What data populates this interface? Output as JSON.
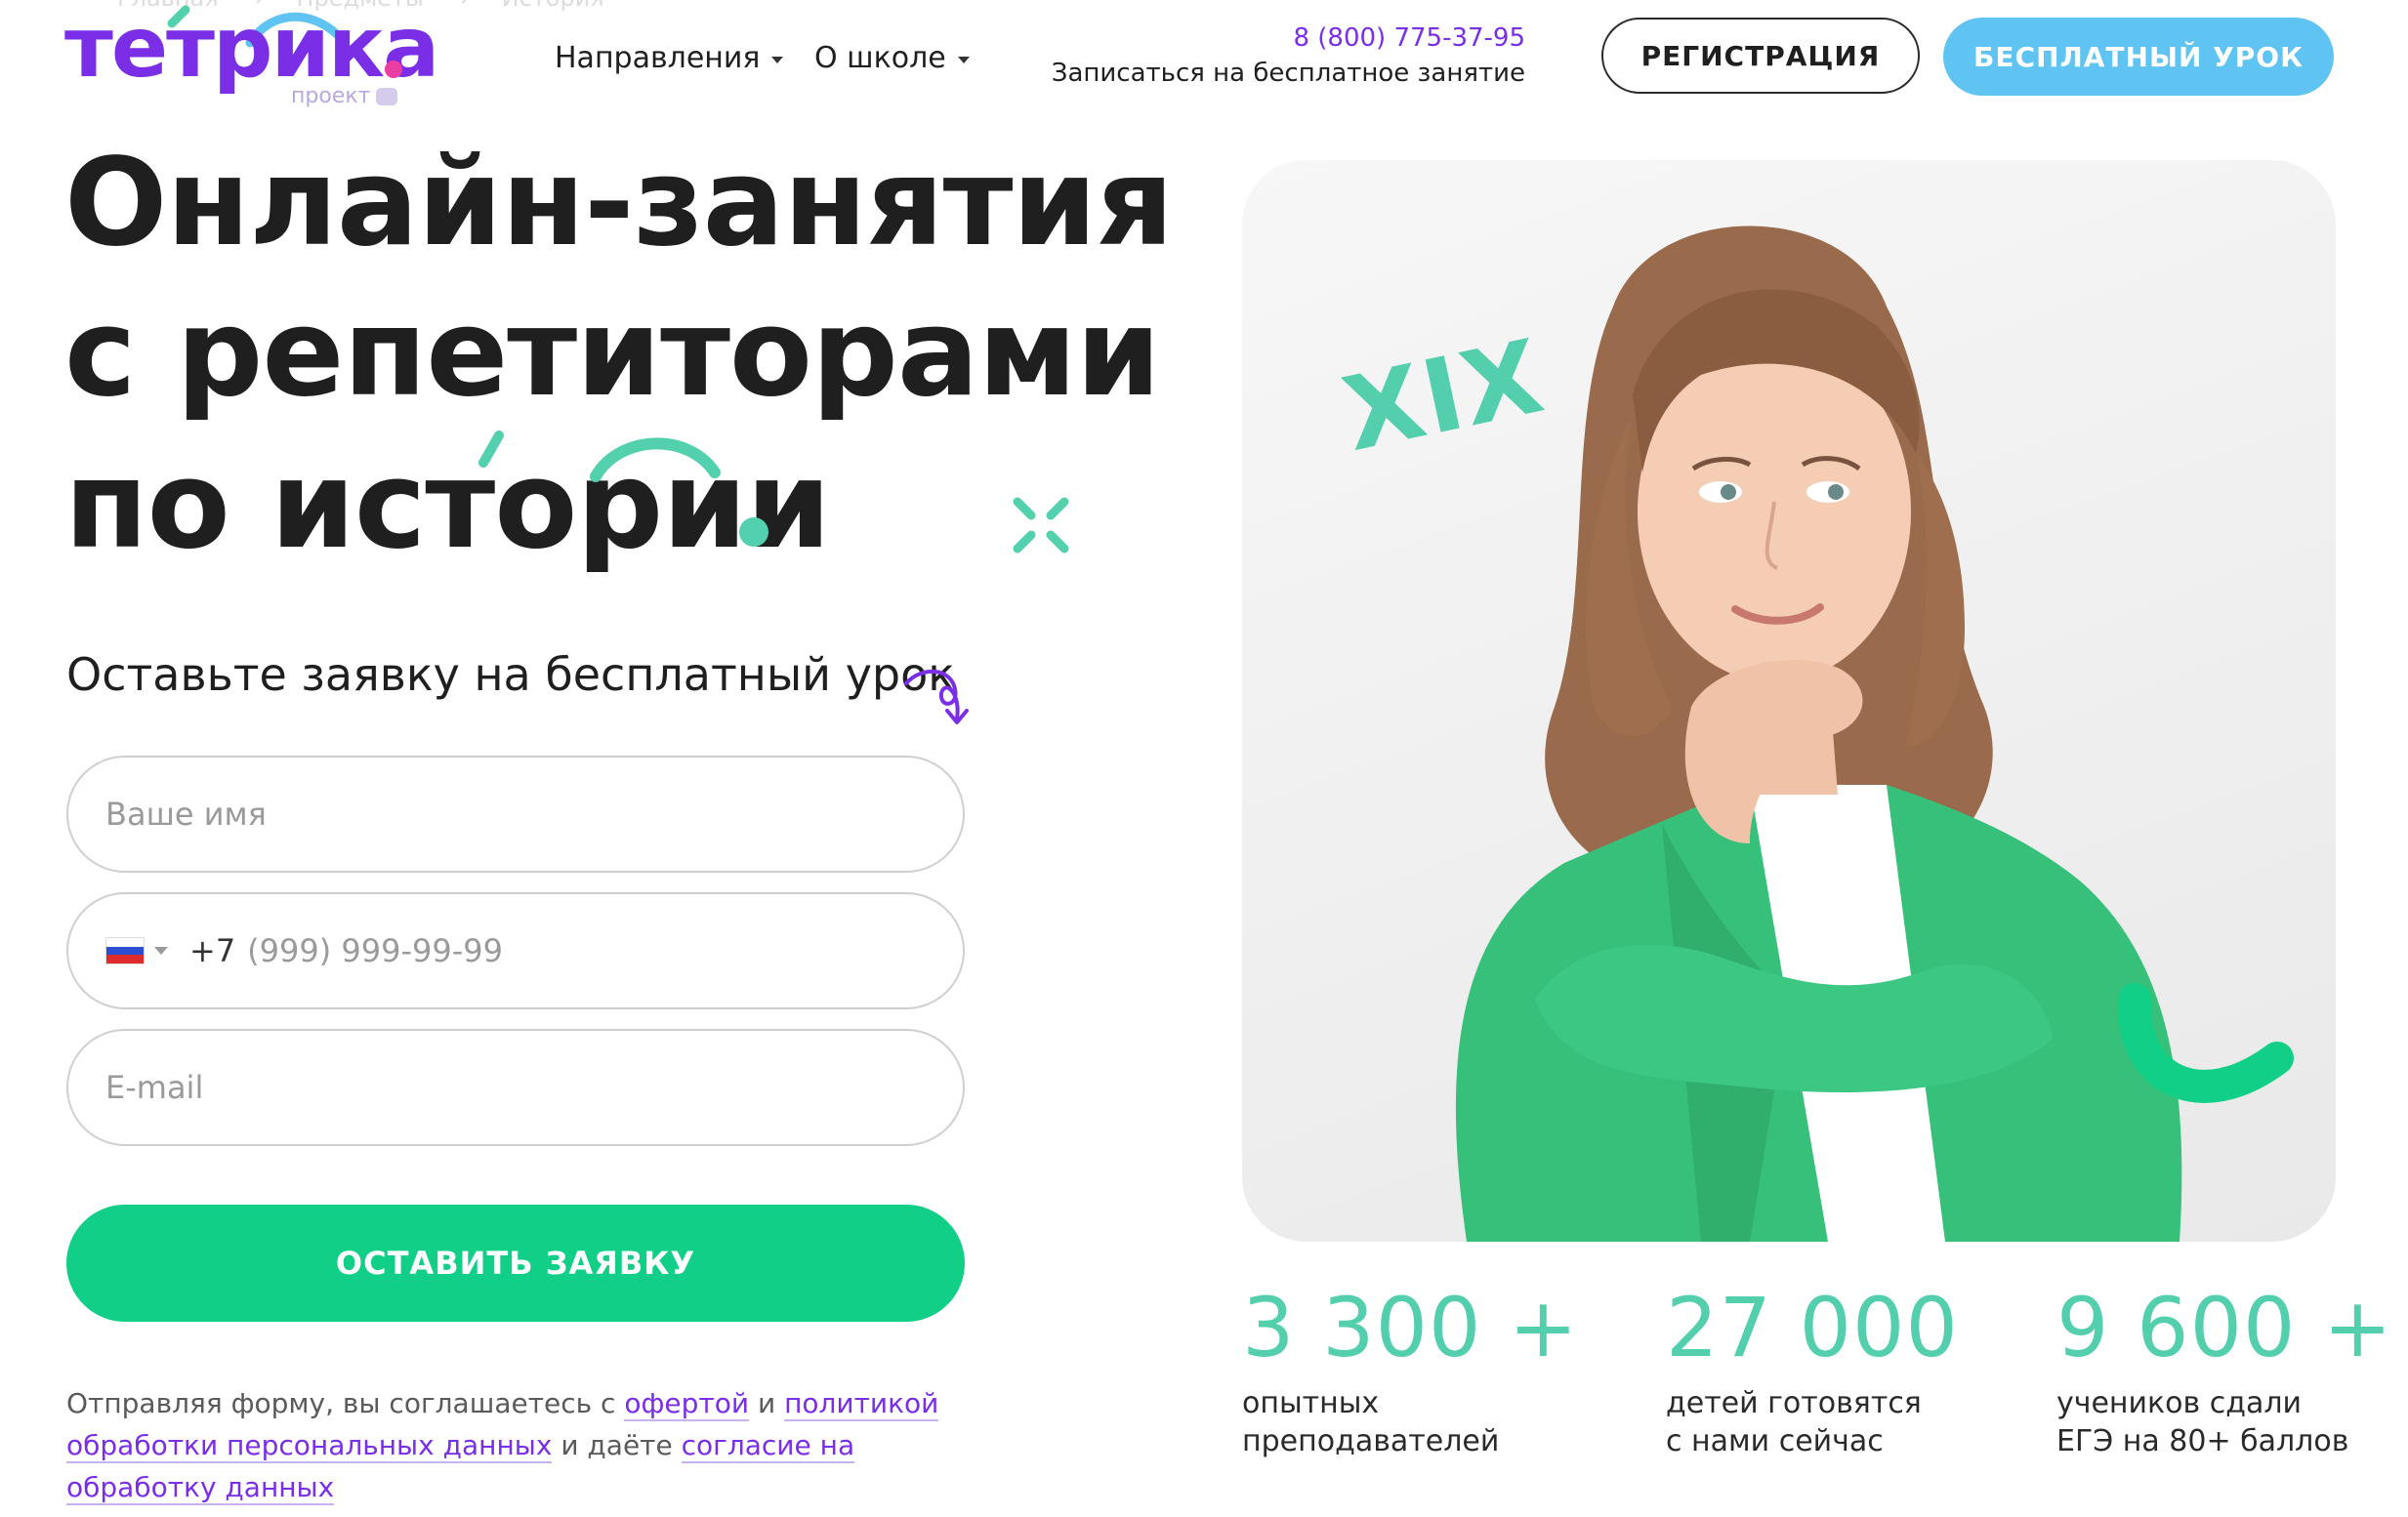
{
  "breadcrumb": [
    "Главная",
    "Предметы",
    "История"
  ],
  "logo": {
    "text": "тетрика",
    "sub": "проект"
  },
  "nav": {
    "directions": "Направления",
    "about": "О школе"
  },
  "contact": {
    "phone": "8 (800) 775-37-95",
    "cta": "Записаться на бесплатное занятие"
  },
  "header_buttons": {
    "register": "РЕГИСТРАЦИЯ",
    "free_lesson": "БЕСПЛАТНЫЙ УРОК"
  },
  "hero": {
    "line1": "Онлайн-занятия",
    "line2": "с репетиторами",
    "line3": "по истории",
    "roman": "XIX"
  },
  "form": {
    "title": "Оставьте заявку на бесплатный урок",
    "name_placeholder": "Ваше имя",
    "phone_code": "+7",
    "phone_placeholder": "(999) 999-99-99",
    "email_placeholder": "E-mail",
    "submit": "ОСТАВИТЬ ЗАЯВКУ"
  },
  "legal": {
    "t1": "Отправляя форму, вы соглашаетесь с ",
    "link1": "офертой",
    "t2": " и ",
    "link2": "политикой обработки персональных данных",
    "t3": " и даёте ",
    "link3": "согласие на обработку данных"
  },
  "stats": [
    {
      "value": "3 300 +",
      "label": "опытных\nпреподавателей"
    },
    {
      "value": "27 000",
      "label": "детей готовятся\nс нами сейчас"
    },
    {
      "value": "9 600 +",
      "label": "учеников сдали\nЕГЭ на 80+ баллов"
    }
  ],
  "colors": {
    "brand": "#7a2ee6",
    "accent_green": "#11cf86",
    "mint": "#53cfae",
    "sky": "#5fc4f1"
  }
}
